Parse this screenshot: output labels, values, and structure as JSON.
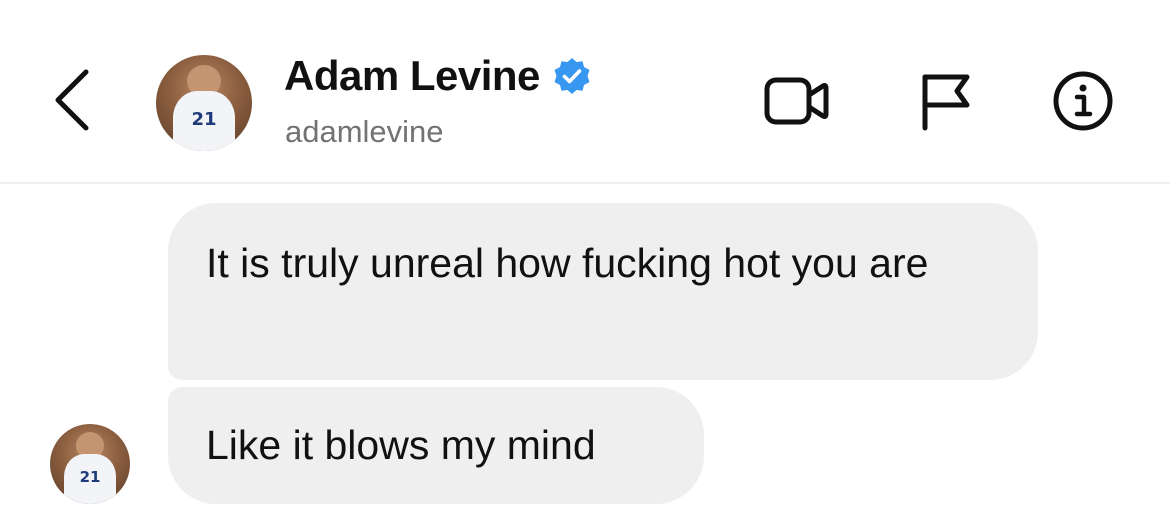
{
  "conversation": {
    "display_name": "Adam Levine",
    "username": "adamlevine",
    "verified": true,
    "avatar_jersey_number": "21"
  },
  "header": {
    "back_icon": "chevron-left-icon",
    "actions": [
      "video-camera-icon",
      "flag-icon",
      "info-icon"
    ]
  },
  "messages": [
    {
      "sender": "adamlevine",
      "text": "It is truly unreal how fucking hot you are"
    },
    {
      "sender": "adamlevine",
      "text": "Like it blows my mind"
    }
  ],
  "colors": {
    "verified_badge": "#3897f0",
    "bubble_background": "#efefef",
    "username_text": "#737373",
    "divider": "#efefef"
  }
}
